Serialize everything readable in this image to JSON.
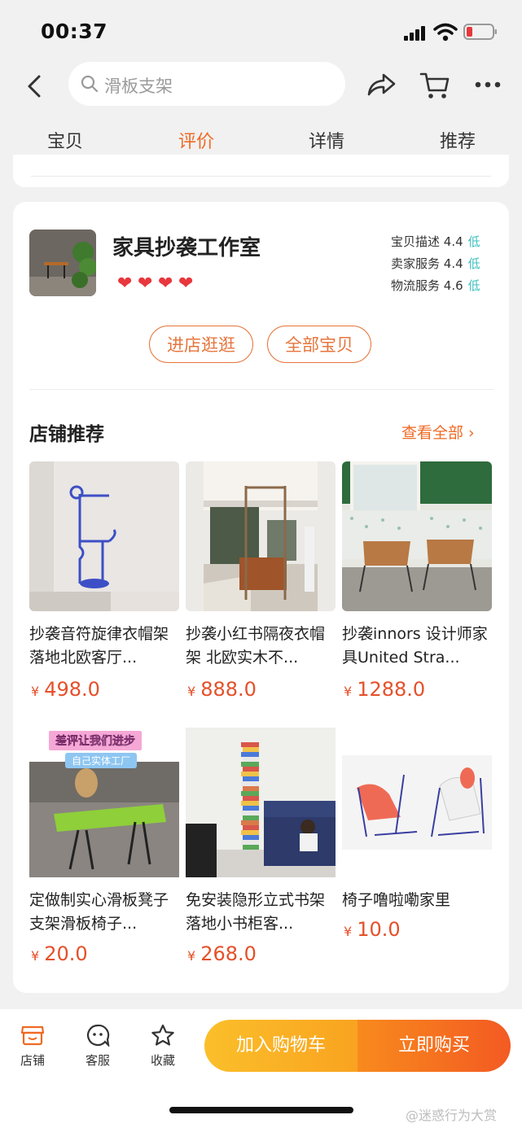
{
  "status_bar": {
    "time": "00:37"
  },
  "search": {
    "placeholder": "滑板支架"
  },
  "tabs": [
    {
      "label": "宝贝",
      "active": false
    },
    {
      "label": "评价",
      "active": true
    },
    {
      "label": "详情",
      "active": false
    },
    {
      "label": "推荐",
      "active": false
    }
  ],
  "shop": {
    "name": "家具抄袭工作室",
    "hearts": 4,
    "ratings": [
      {
        "label": "宝贝描述",
        "score": "4.4",
        "level": "低"
      },
      {
        "label": "卖家服务",
        "score": "4.4",
        "level": "低"
      },
      {
        "label": "物流服务",
        "score": "4.6",
        "level": "低"
      }
    ],
    "visit_button": "进店逛逛",
    "all_items_button": "全部宝贝"
  },
  "recommend": {
    "title": "店铺推荐",
    "view_all": "查看全部 ›",
    "products": [
      {
        "name": "抄袭音符旋律衣帽架落地北欧客厅...",
        "currency": "¥",
        "price": "498.0"
      },
      {
        "name": "抄袭小红书隔夜衣帽架 北欧实木不...",
        "currency": "¥",
        "price": "888.0"
      },
      {
        "name": "抄袭innors 设计师家具United Stra...",
        "currency": "¥",
        "price": "1288.0"
      },
      {
        "name": "定做制实心滑板凳子支架滑板椅子...",
        "currency": "¥",
        "price": "20.0",
        "banner": "差评让我们进步",
        "sub_banner": "自己实体工厂"
      },
      {
        "name": "免安装隐形立式书架落地小书柜客...",
        "currency": "¥",
        "price": "268.0"
      },
      {
        "name": "椅子噜啦嘞家里",
        "currency": "¥",
        "price": "10.0"
      }
    ]
  },
  "bottom_bar": {
    "shop_label": "店铺",
    "service_label": "客服",
    "favorite_label": "收藏",
    "add_to_cart": "加入购物车",
    "buy_now": "立即购买"
  },
  "watermark": "@迷惑行为大赏",
  "colors": {
    "accent": "#ef6a24",
    "price": "#e5502a",
    "cart": "#f9a320",
    "buy": "#f35a22"
  }
}
